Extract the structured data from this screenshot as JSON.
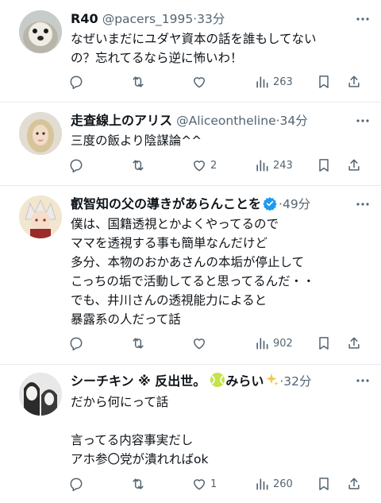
{
  "posts": [
    {
      "display_name": "R40",
      "handle": "@pacers_1995",
      "sep": "·",
      "time": "33分",
      "text": "なぜいまだにユダヤ資本の話を誰もしてない\nの？忘れてるなら逆に怖いわ！",
      "replies": "",
      "reposts": "",
      "likes": "",
      "views": "263"
    },
    {
      "display_name": "走査線上のアリス",
      "handle": "@Aliceontheline",
      "sep": "·",
      "time": "34分",
      "text": "三度の飯より陰謀論^^",
      "replies": "",
      "reposts": "",
      "likes": "2",
      "views": "243"
    },
    {
      "display_name": "叡智知の父の導きがあらんことを",
      "handle": "",
      "sep": "·",
      "time": "49分",
      "text": "僕は、国籍透視とかよくやってるので\nママを透視する事も簡単なんだけど\n多分、本物のおかあさんの本垢が停止して\nこっちの垢で活動してると思ってるんだ・・\nでも、井川さんの透視能力によると\n暴露系の人だって話",
      "replies": "",
      "reposts": "",
      "likes": "",
      "views": "902"
    },
    {
      "display_name": "シーチキン ※ 反出世。",
      "display_name_b": "みらい",
      "handle": "",
      "sep": "·",
      "time": "32分",
      "text": "だから何にって話\n\n言ってる内容事実だし\nアホ参〇党が潰れればok",
      "replies": "",
      "reposts": "",
      "likes": "1",
      "views": "260"
    }
  ],
  "colors": {
    "text": "#0f1419",
    "secondary": "#536471",
    "separator": "#e6e9ec",
    "verified": "#1d9bf0"
  },
  "icons": [
    "reply-icon",
    "repost-icon",
    "like-icon",
    "views-icon",
    "bookmark-icon",
    "share-icon",
    "more-icon",
    "verified-badge-icon",
    "tennis-ball-icon",
    "sparkles-icon"
  ]
}
